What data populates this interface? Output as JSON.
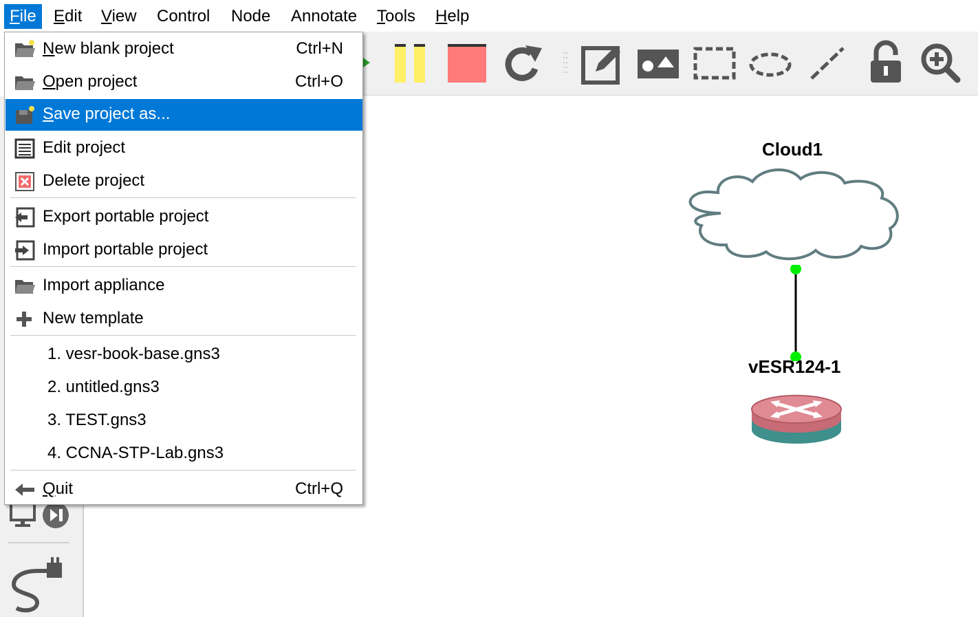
{
  "menubar": {
    "items": [
      {
        "label": "File",
        "mnemonic": "F",
        "rest": "ile"
      },
      {
        "label": "Edit",
        "mnemonic": "E",
        "rest": "dit"
      },
      {
        "label": "View",
        "mnemonic": "V",
        "rest": "iew"
      },
      {
        "label": "Control",
        "mnemonic": "",
        "rest": "Control"
      },
      {
        "label": "Node",
        "mnemonic": "",
        "rest": "Node"
      },
      {
        "label": "Annotate",
        "mnemonic": "",
        "rest": "Annotate"
      },
      {
        "label": "Tools",
        "mnemonic": "T",
        "rest": "ools"
      },
      {
        "label": "Help",
        "mnemonic": "H",
        "rest": "elp"
      }
    ]
  },
  "file_menu": {
    "new_blank": {
      "mnemonic": "N",
      "rest": "ew blank project",
      "shortcut": "Ctrl+N",
      "icon": "folder-new-icon"
    },
    "open": {
      "mnemonic": "O",
      "rest": "pen project",
      "shortcut": "Ctrl+O",
      "icon": "folder-open-icon"
    },
    "save_as": {
      "mnemonic": "S",
      "rest": "ave project as...",
      "icon": "save-icon"
    },
    "edit": {
      "label": "Edit project",
      "icon": "edit-list-icon"
    },
    "delete": {
      "label": "Delete project",
      "icon": "delete-icon"
    },
    "export": {
      "label": "Export portable project",
      "icon": "export-icon"
    },
    "import_portable": {
      "label": "Import portable project",
      "icon": "import-icon"
    },
    "import_appliance": {
      "label": "Import appliance",
      "icon": "folder-open-icon"
    },
    "new_template": {
      "label": "New template",
      "icon": "plus-icon"
    },
    "recent": [
      "1. vesr-book-base.gns3",
      "2. untitled.gns3",
      "3. TEST.gns3",
      "4. CCNA-STP-Lab.gns3"
    ],
    "quit": {
      "mnemonic": "Q",
      "rest": "uit",
      "shortcut": "Ctrl+Q",
      "icon": "back-arrow-icon"
    }
  },
  "toolbar": {
    "icons": [
      "pause-icon",
      "stop-icon",
      "reload-icon",
      "edit-note-icon",
      "insert-image-icon",
      "rectangle-icon",
      "ellipse-icon",
      "line-icon",
      "lock-icon",
      "zoom-in-icon"
    ],
    "colors": {
      "pause": "#fff066",
      "stop": "#ff7b7b",
      "icon_gray": "#555555"
    }
  },
  "topology": {
    "nodes": [
      {
        "name": "Cloud1",
        "type": "cloud"
      },
      {
        "name": "vESR124-1",
        "type": "router"
      }
    ],
    "link_colors": {
      "endpoint": "#00ee00",
      "line": "#000000"
    }
  }
}
